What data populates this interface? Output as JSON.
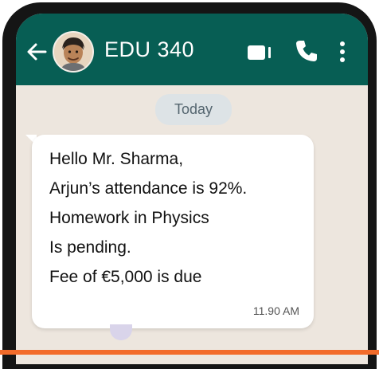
{
  "header": {
    "title": "EDU 340",
    "back_icon": "arrow-left-icon",
    "avatar": "contact-avatar",
    "actions": [
      "video-call-icon",
      "phone-icon",
      "more-vertical-icon"
    ],
    "bg_color": "#075e54"
  },
  "chat": {
    "day_label": "Today",
    "message": {
      "lines": [
        "Hello Mr. Sharma,",
        "Arjun’s attendance is 92%.",
        "Homework in Physics",
        "Is pending.",
        "Fee of €5,000 is due"
      ],
      "time": "11.90 AM"
    },
    "bg_color": "#ede6de"
  }
}
